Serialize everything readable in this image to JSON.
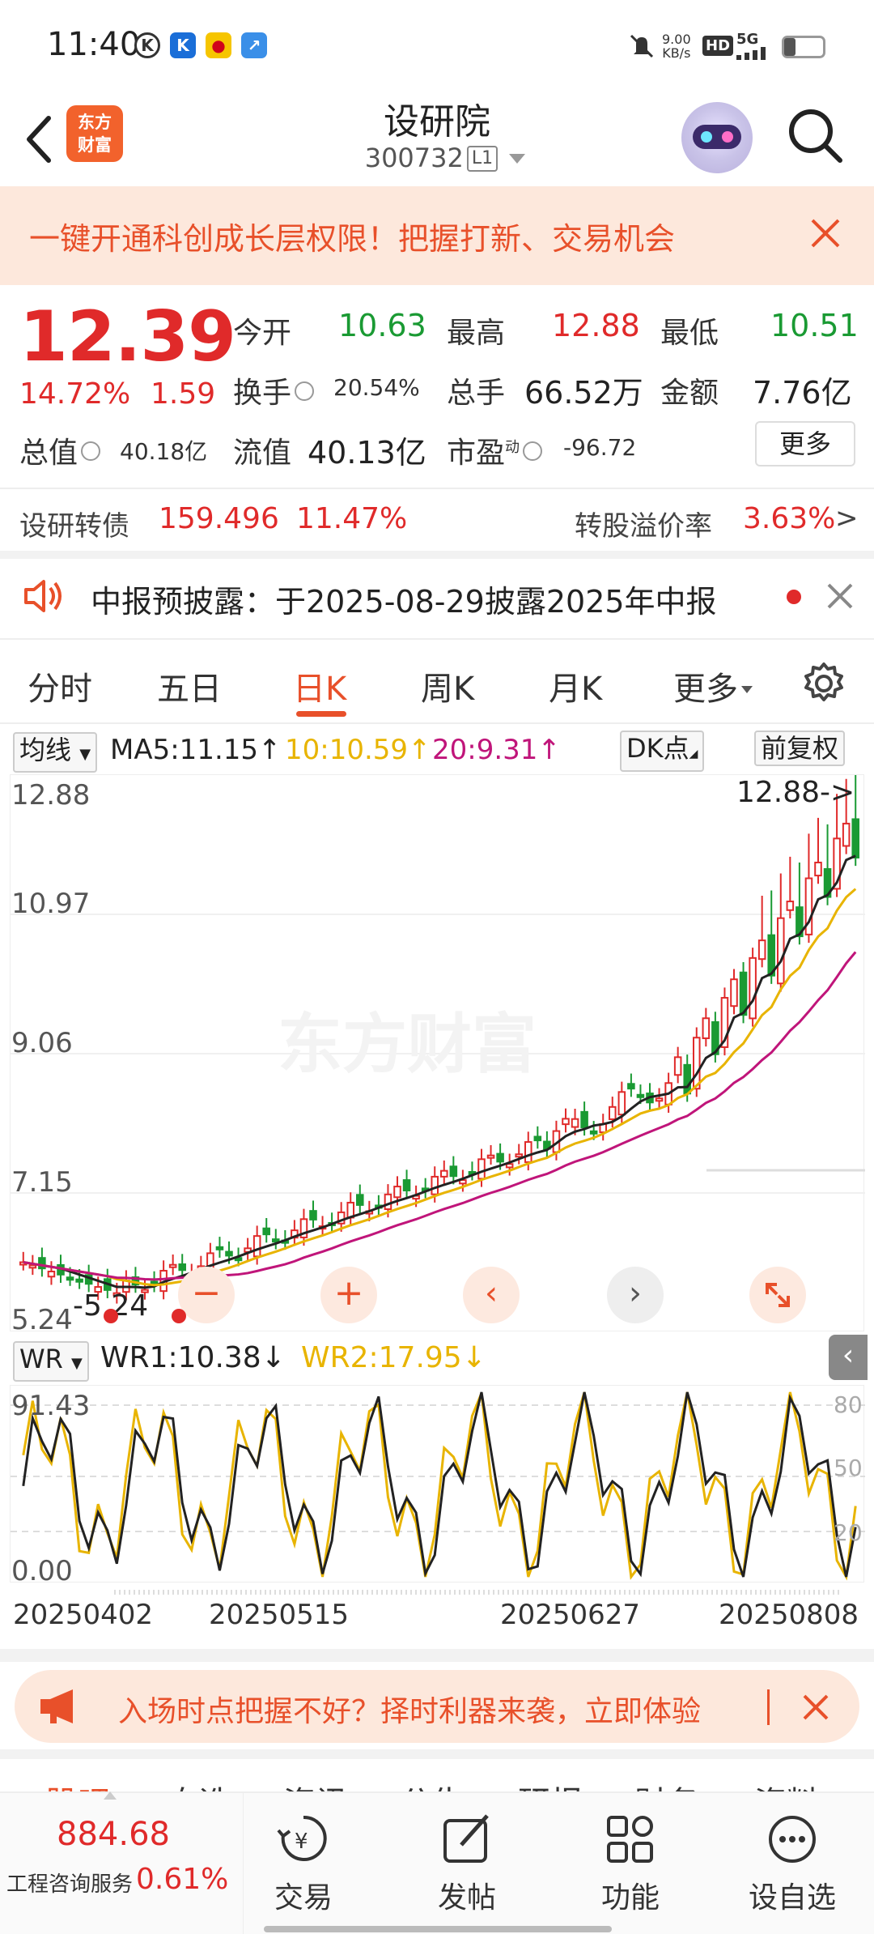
{
  "status_bar": {
    "time": "11:40",
    "net_speed_value": "9.00",
    "net_speed_unit": "KB/s",
    "hd": "HD",
    "signal": "5G"
  },
  "header": {
    "title": "设研院",
    "code": "300732",
    "level": "L1",
    "logo_line1": "东方",
    "logo_line2": "财富"
  },
  "promo": {
    "text": "一键开通科创成长层权限！把握打新、交易机会"
  },
  "quote": {
    "price": "12.39",
    "change_pct": "14.72%",
    "change": "1.59",
    "open_label": "今开",
    "open": "10.63",
    "high_label": "最高",
    "high": "12.88",
    "low_label": "最低",
    "low": "10.51",
    "turnover_label": "换手",
    "turnover": "20.54%",
    "volume_label": "总手",
    "volume": "66.52万",
    "amount_label": "金额",
    "amount": "7.76亿",
    "mktcap_label": "总值",
    "mktcap": "40.18亿",
    "float_label": "流值",
    "float_cap": "40.13亿",
    "pe_label": "市盈",
    "pe_sup": "动",
    "pe": "-96.72",
    "more_label": "更多"
  },
  "convertible": {
    "label": "设研转债",
    "price": "159.496",
    "pct": "11.47%",
    "premium_label": "转股溢价率",
    "premium": "3.63%",
    "arrow": ">"
  },
  "notice": {
    "text": "中报预披露：于2025-08-29披露2025年中报"
  },
  "tabs": [
    "分时",
    "五日",
    "日K",
    "周K",
    "月K",
    "更多"
  ],
  "active_tab": "日K",
  "ma_row": {
    "selector": "均线",
    "ma5": "MA5:11.15",
    "ma10": "10:10.59",
    "ma20": "20:9.31",
    "dk": "DK点",
    "adjust": "前复权"
  },
  "chart_axis": {
    "y1": "12.88",
    "y2": "10.97",
    "y3": "9.06",
    "y4": "7.15",
    "y5": "5.24",
    "max_label": "12.88->",
    "min_label": "-5.24",
    "watermark": "东方财富"
  },
  "wr_row": {
    "selector": "WR",
    "wr1": "WR1:10.38",
    "wr2": "WR2:17.95",
    "y_top": "91.43",
    "y_bottom": "0.00",
    "r80": "80",
    "r50": "50",
    "r20": "20"
  },
  "dates": [
    "20250402",
    "20250515",
    "20250627",
    "20250808"
  ],
  "timing_banner": {
    "text": "入场时点把握不好？择时利器来袭，立即体验"
  },
  "bottom_tabs": [
    "股吧",
    "自选",
    "资讯",
    "公告",
    "研报",
    "财务",
    "资料"
  ],
  "index_info": {
    "value": "884.68",
    "name": "工程咨询服务",
    "pct": "0.61%"
  },
  "bottom_bar": [
    "交易",
    "发帖",
    "功能",
    "设自选"
  ],
  "colors": {
    "up": "#e02a2a",
    "down": "#1a9a33",
    "accent": "#e8502a",
    "ma5": "#222222",
    "ma10": "#e8b400",
    "ma20": "#c0157a"
  },
  "chart_data": {
    "type": "candlestick",
    "ylim": [
      5.24,
      12.88
    ],
    "last_candles": [
      {
        "open": 10.63,
        "close": 12.39,
        "high": 12.88,
        "low": 10.51
      }
    ],
    "ma": {
      "MA5": 11.15,
      "MA10": 10.59,
      "MA20": 9.31
    },
    "wr": {
      "WR1": 10.38,
      "WR2": 17.95,
      "ylim": [
        0.0,
        91.43
      ]
    }
  }
}
